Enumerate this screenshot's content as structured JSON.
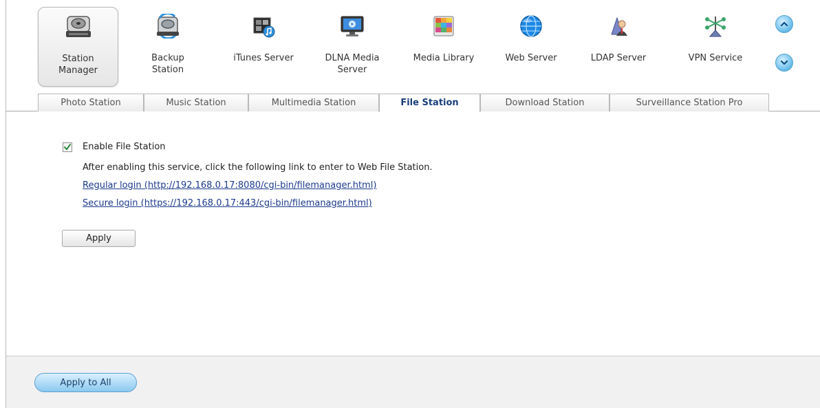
{
  "apps": [
    {
      "label": "Station\nManager",
      "icon": "station-manager-icon",
      "selected": true
    },
    {
      "label": "Backup\nStation",
      "icon": "backup-station-icon"
    },
    {
      "label": "iTunes Server",
      "icon": "itunes-server-icon"
    },
    {
      "label": "DLNA Media\nServer",
      "icon": "dlna-media-server-icon"
    },
    {
      "label": "Media Library",
      "icon": "media-library-icon"
    },
    {
      "label": "Web Server",
      "icon": "web-server-icon"
    },
    {
      "label": "LDAP Server",
      "icon": "ldap-server-icon"
    },
    {
      "label": "VPN Service",
      "icon": "vpn-service-icon"
    }
  ],
  "tabs": [
    {
      "label": "Photo Station"
    },
    {
      "label": "Music Station"
    },
    {
      "label": "Multimedia Station"
    },
    {
      "label": "File Station",
      "active": true
    },
    {
      "label": "Download Station"
    },
    {
      "label": "Surveillance Station Pro"
    }
  ],
  "content": {
    "enable_label": "Enable File Station",
    "enabled": true,
    "description": "After enabling this service, click the following link to enter to Web File Station.",
    "regular_link": "Regular login (http://192.168.0.17:8080/cgi-bin/filemanager.html)",
    "secure_link": "Secure login (https://192.168.0.17:443/cgi-bin/filemanager.html)",
    "apply_label": "Apply"
  },
  "footer": {
    "apply_all_label": "Apply to All"
  },
  "colors": {
    "link": "#1c3a8c",
    "active_tab_text": "#1a3f7a",
    "accent_blue": "#8cc9ef"
  }
}
